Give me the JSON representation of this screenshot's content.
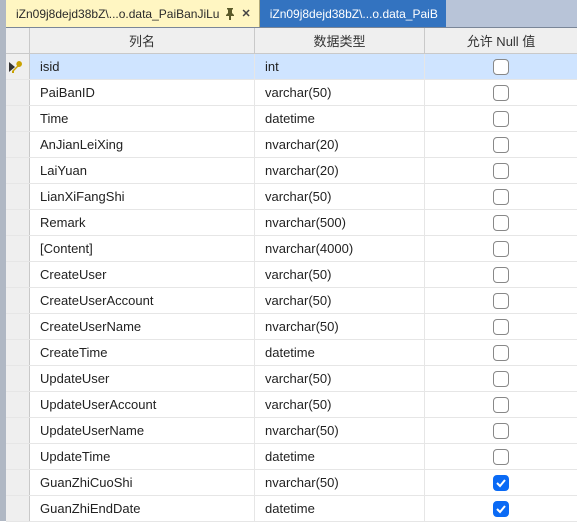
{
  "tabs": {
    "active": {
      "label": "iZn09j8dejd38bZ\\...o.data_PaiBanJiLu"
    },
    "inactive": {
      "label": "iZn09j8dejd38bZ\\...o.data_PaiB"
    }
  },
  "headers": {
    "name": "列名",
    "type": "数据类型",
    "nullable": "允许 Null 值"
  },
  "rows": [
    {
      "name": "isid",
      "type": "int",
      "null": false,
      "pk": true,
      "selected": true
    },
    {
      "name": "PaiBanID",
      "type": "varchar(50)",
      "null": false
    },
    {
      "name": "Time",
      "type": "datetime",
      "null": false
    },
    {
      "name": "AnJianLeiXing",
      "type": "nvarchar(20)",
      "null": false
    },
    {
      "name": "LaiYuan",
      "type": "nvarchar(20)",
      "null": false
    },
    {
      "name": "LianXiFangShi",
      "type": "varchar(50)",
      "null": false
    },
    {
      "name": "Remark",
      "type": "nvarchar(500)",
      "null": false
    },
    {
      "name": "[Content]",
      "type": "nvarchar(4000)",
      "null": false
    },
    {
      "name": "CreateUser",
      "type": "varchar(50)",
      "null": false
    },
    {
      "name": "CreateUserAccount",
      "type": "varchar(50)",
      "null": false
    },
    {
      "name": "CreateUserName",
      "type": "nvarchar(50)",
      "null": false
    },
    {
      "name": "CreateTime",
      "type": "datetime",
      "null": false
    },
    {
      "name": "UpdateUser",
      "type": "varchar(50)",
      "null": false
    },
    {
      "name": "UpdateUserAccount",
      "type": "varchar(50)",
      "null": false
    },
    {
      "name": "UpdateUserName",
      "type": "nvarchar(50)",
      "null": false
    },
    {
      "name": "UpdateTime",
      "type": "datetime",
      "null": false
    },
    {
      "name": "GuanZhiCuoShi",
      "type": "nvarchar(50)",
      "null": true
    },
    {
      "name": "GuanZhiEndDate",
      "type": "datetime",
      "null": true
    }
  ]
}
